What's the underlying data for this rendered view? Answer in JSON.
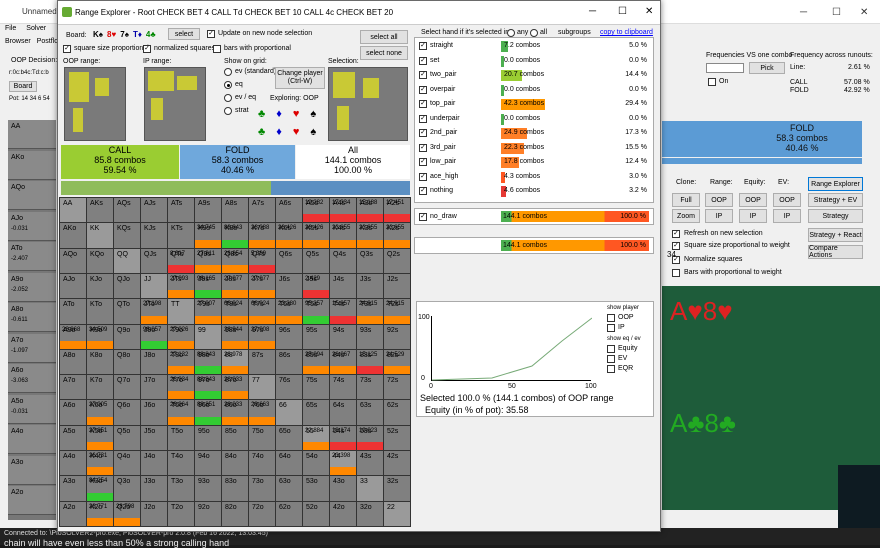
{
  "bg": {
    "title": "Unnamed",
    "menu": [
      "File",
      "Solver"
    ],
    "tabs": [
      "Browser",
      "Postflo"
    ],
    "oop_decision": "OOP Decision:",
    "board_short": "r:0c:b4c:Td:c:b",
    "board_btn": "Board",
    "pot": "Pot: 14 34 6 54",
    "freq_label": "Frequencies VS one combo",
    "freq_pick": "Pick",
    "freq_on": "On",
    "runouts_title": "Frequency across runouts:",
    "line_label": "Line:",
    "line_val": "2.61 %",
    "call_label": "CALL",
    "call_val": "57.08 %",
    "fold_label": "FOLD",
    "fold_val": "42.92 %",
    "fold_box": {
      "label": "FOLD",
      "combos": "58.3 combos",
      "pct": "40.46 %"
    },
    "clone": "Clone:",
    "range": "Range:",
    "equity": "Equity:",
    "ev": "EV:",
    "range_explorer_btn": "Range Explorer",
    "strategy_ev_btn": "Strategy + EV",
    "strategy_btn": "Strategy",
    "strategy_react_btn": "Strategy + React",
    "compare_btn": "Compare Actions",
    "full_btn": "Full",
    "zoom_btn": "Zoom",
    "oop": "OOP",
    "ip": "IP",
    "opts": [
      "Refresh on new selection",
      "Square size proportional to weight",
      "Normalize squares",
      "Bars with proportional to weight"
    ],
    "num34": "34",
    "left_labels": [
      "AA",
      "AKo",
      "AQo",
      "AJo",
      "ATo",
      "A9o",
      "A8o",
      "A7o",
      "A6o",
      "A5o",
      "A4o",
      "A3o",
      "A2o"
    ],
    "left_vals": [
      "",
      "",
      "",
      "-0.031",
      "-2.407",
      "-2.052",
      "-0.611",
      "-1.097",
      "-3.063",
      "-0.031",
      "",
      "",
      ""
    ],
    "status": "Connected to: \\PioSOLVER2-pro.exe, PioSOLVER-pro 2.0.8 (Feb 16 2022, 13:03:45)",
    "subtitle": "chain will have even less than 50% a strong calling hand"
  },
  "win": {
    "title": "Range Explorer - Root CHECK BET 4 CALL Td CHECK BET 10 CALL 4c CHECK BET 20",
    "board_label": "Board:",
    "board_cards": [
      {
        "c": "K",
        "s": "♠",
        "col": "#000"
      },
      {
        "c": "8",
        "s": "♥",
        "col": "#d00"
      },
      {
        "c": "7",
        "s": "♠",
        "col": "#000"
      },
      {
        "c": "T",
        "s": "♦",
        "col": "#00a"
      },
      {
        "c": "4",
        "s": "♣",
        "col": "#080"
      }
    ],
    "select_btn": "select",
    "update_label": "Update on new node selection",
    "sq_prop": "square size proportional",
    "norm_sq": "normalized squares",
    "bars_prop": "bars with proportional",
    "oop_range": "OOP range:",
    "ip_range": "IP range:",
    "show_grid": "Show on grid:",
    "grid_opts": [
      "ev (standard)",
      "eq",
      "ev / eq",
      "strat"
    ],
    "change_player": "Change player (Ctrl-W)",
    "exploring": "Exploring: OOP",
    "selection": "Selection:",
    "select_all": "select all",
    "select_none": "select none",
    "call": {
      "label": "CALL",
      "combos": "85.8 combos",
      "pct": "59.54 %"
    },
    "fold": {
      "label": "FOLD",
      "combos": "58.3 combos",
      "pct": "40.46 %"
    },
    "all": {
      "label": "All",
      "combos": "144.1 combos",
      "pct": "100.00 %"
    },
    "hand_header": "Select hand if it's selected in",
    "any": "any",
    "all_lbl": "all",
    "subgroups": "subgroups",
    "copy": "copy to clipboard",
    "hands": [
      {
        "name": "straight",
        "combos": "7.2 combos",
        "pct": "5.0 %",
        "w": 0.05,
        "col": "#4caf50"
      },
      {
        "name": "set",
        "combos": "0.0 combos",
        "pct": "0.0 %",
        "w": 0,
        "col": "#4caf50"
      },
      {
        "name": "two_pair",
        "combos": "20.7 combos",
        "pct": "14.4 %",
        "w": 0.144,
        "col": "#9acd32"
      },
      {
        "name": "overpair",
        "combos": "0.0 combos",
        "pct": "0.0 %",
        "w": 0,
        "col": "#4caf50"
      },
      {
        "name": "top_pair",
        "combos": "42.3 combos",
        "pct": "29.4 %",
        "w": 0.294,
        "col": "#ff9800"
      },
      {
        "name": "underpair",
        "combos": "0.0 combos",
        "pct": "0.0 %",
        "w": 0,
        "col": "#4caf50"
      },
      {
        "name": "2nd_pair",
        "combos": "24.9 combos",
        "pct": "17.3 %",
        "w": 0.173,
        "col": "#ff7f27"
      },
      {
        "name": "3rd_pair",
        "combos": "22.3 combos",
        "pct": "15.5 %",
        "w": 0.155,
        "col": "#ff7f27"
      },
      {
        "name": "low_pair",
        "combos": "17.8 combos",
        "pct": "12.4 %",
        "w": 0.124,
        "col": "#ff7f27"
      },
      {
        "name": "ace_high",
        "combos": "4.3 combos",
        "pct": "3.0 %",
        "w": 0.03,
        "col": "#ff5722"
      },
      {
        "name": "nothing",
        "combos": "4.6 combos",
        "pct": "3.2 %",
        "w": 0.032,
        "col": "#e53935"
      }
    ],
    "no_draw": {
      "name": "no_draw",
      "combos": "144.1 combos",
      "pct": "100.0 %"
    },
    "total": {
      "combos": "144.1 combos",
      "pct": "100.0 %"
    },
    "graph_y": [
      "100",
      "0"
    ],
    "graph_x": [
      "0",
      "50",
      "100"
    ],
    "show_player": "show player",
    "oop": "OOP",
    "ip": "IP",
    "show_eq": "show eq / ev",
    "equity": "Equity",
    "ev": "EV",
    "eqr": "EQR",
    "selected_text": "Selected 100.0 % (144.1 combos) of OOP range",
    "equity_text": "Equity (in % of pot): 35.58"
  },
  "ranks": [
    "A",
    "K",
    "Q",
    "J",
    "T",
    "9",
    "8",
    "7",
    "6",
    "5",
    "4",
    "3",
    "2"
  ],
  "cell_vals": {
    "0,9": "19.282",
    "0,10": "17.334",
    "0,11": "15.188",
    "0,12": "17.451",
    "1,5": "34.745",
    "1,6": "88.843",
    "1,7": "26.088",
    "1,8": "26.426",
    "1,9": "26.426",
    "1,10": "23.855",
    "1,11": "23.855",
    "1,12": "23.855",
    "2,4": "8.617",
    "2,5": "27.811",
    "2,6": "26.854",
    "2,7": "5.389",
    "3,4": "27.093",
    "3,5": "96.165",
    "3,6": "27.077",
    "3,7": "27.077",
    "3,9": "2.429",
    "4,3": "27.198",
    "4,5": "27.007",
    "4,6": "66.024",
    "4,7": "66.024",
    "4,8": "23.380",
    "4,9": "95.357",
    "4,10": "15.957",
    "4,11": "24.915",
    "4,12": "24.915",
    "5,0": "26.868",
    "5,1": "34.509",
    "5,3": "96.057",
    "5,4": "27.026",
    "5,6": "26.944",
    "5,7": "27.008",
    "6,4": "27.132",
    "6,5": "88.843",
    "6,6": "26.978",
    "6,9": "25.094",
    "6,10": "26.067",
    "6,11": "15.125",
    "6,12": "24.529",
    "7,4": "26.934",
    "7,5": "88.843",
    "7,6": "26.033",
    "8,1": "27.005",
    "8,4": "26.964",
    "8,5": "88.851",
    "8,6": "26.033",
    "8,7": "28.663",
    "9,1": "27.851",
    "9,9": "22.884",
    "9,10": "18.174",
    "9,11": "19.023",
    "10,1": "26.731",
    "10,10": "23.398",
    "11,1": "84.254",
    "12,1": "28.771",
    "12,2": "28.798"
  }
}
